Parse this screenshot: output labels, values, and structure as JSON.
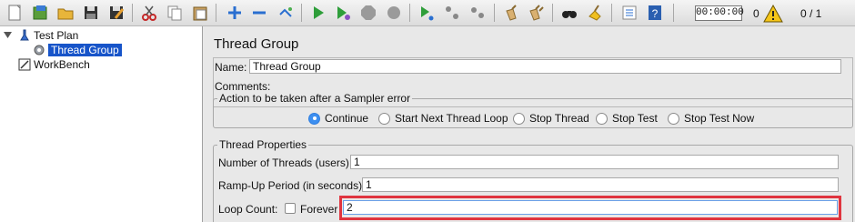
{
  "toolbar": {
    "buttons": [
      "new-icon",
      "templates-icon",
      "open-icon",
      "save-icon",
      "save-as-icon",
      "cut-icon",
      "copy-icon",
      "paste-icon",
      "expand-icon",
      "collapse-icon",
      "toggle-icon",
      "start-icon",
      "start-no-pauses-icon",
      "stop-icon",
      "shutdown-icon",
      "remote-start-icon",
      "remote-stop-icon",
      "remote-shutdown-icon",
      "clear-icon",
      "clear-all-icon",
      "search-icon",
      "reset-search-icon",
      "function-helper-icon",
      "help-icon"
    ],
    "timer": "00:00:00",
    "error_count": "0",
    "threads": "0 / 1"
  },
  "tree": {
    "test_plan": "Test Plan",
    "thread_group": "Thread Group",
    "workbench": "WorkBench"
  },
  "panel": {
    "title": "Thread Group",
    "name_label": "Name:",
    "name_value": "Thread Group",
    "comments_label": "Comments:",
    "sampler_error": {
      "legend": "Action to be taken after a Sampler error",
      "options": [
        "Continue",
        "Start Next Thread Loop",
        "Stop Thread",
        "Stop Test",
        "Stop Test Now"
      ],
      "selected": "Continue"
    },
    "thread_properties": {
      "legend": "Thread Properties",
      "num_threads_label": "Number of Threads (users):",
      "num_threads_value": "1",
      "ramp_up_label": "Ramp-Up Period (in seconds):",
      "ramp_up_value": "1",
      "loop_count_label": "Loop Count:",
      "forever_label": "Forever",
      "forever_checked": false,
      "loop_count_value": "2"
    }
  },
  "colors": {
    "selection": "#1754c9",
    "highlight": "#e0353f",
    "radio_selected": "#3d8ff0"
  }
}
